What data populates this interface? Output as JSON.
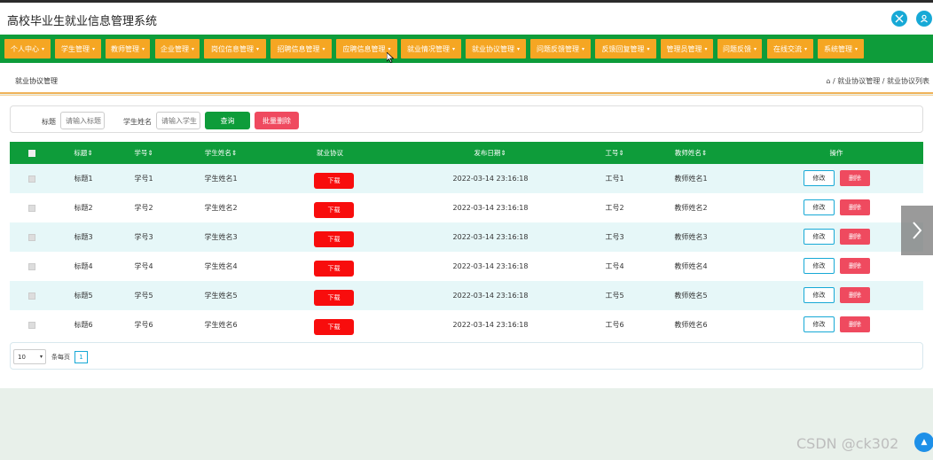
{
  "header": {
    "title": "高校毕业生就业信息管理系统",
    "fullscreen_icon": "fullscreen-icon",
    "user_icon": "user-icon"
  },
  "nav": [
    {
      "label": "个人中心"
    },
    {
      "label": "学生管理"
    },
    {
      "label": "教师管理"
    },
    {
      "label": "企业管理"
    },
    {
      "label": "岗位信息管理"
    },
    {
      "label": "招聘信息管理"
    },
    {
      "label": "应聘信息管理"
    },
    {
      "label": "就业情况管理"
    },
    {
      "label": "就业协议管理"
    },
    {
      "label": "问题反馈管理"
    },
    {
      "label": "反馈回复管理"
    },
    {
      "label": "管理员管理"
    },
    {
      "label": "问题反馈"
    },
    {
      "label": "在线交流"
    },
    {
      "label": "系统管理"
    }
  ],
  "breadcrumb": {
    "page_title": "就业协议管理",
    "home_icon": "home-icon",
    "trail": "/ 就业协议管理 / 就业协议列表"
  },
  "search": {
    "title_label": "标题",
    "title_placeholder": "请输入标题",
    "student_name_label": "学生姓名",
    "student_name_placeholder": "请输入学生",
    "query_label": "查询",
    "batch_delete_label": "批量删除"
  },
  "table": {
    "columns": [
      "标题",
      "学号",
      "学生姓名",
      "就业协议",
      "发布日期",
      "工号",
      "教师姓名",
      "操作"
    ],
    "download_label": "下载",
    "edit_label": "修改",
    "delete_label": "删除",
    "rows": [
      {
        "title": "标题1",
        "student_no": "学号1",
        "student_name": "学生姓名1",
        "date": "2022-03-14 23:16:18",
        "teacher_no": "工号1",
        "teacher_name": "教师姓名1"
      },
      {
        "title": "标题2",
        "student_no": "学号2",
        "student_name": "学生姓名2",
        "date": "2022-03-14 23:16:18",
        "teacher_no": "工号2",
        "teacher_name": "教师姓名2"
      },
      {
        "title": "标题3",
        "student_no": "学号3",
        "student_name": "学生姓名3",
        "date": "2022-03-14 23:16:18",
        "teacher_no": "工号3",
        "teacher_name": "教师姓名3"
      },
      {
        "title": "标题4",
        "student_no": "学号4",
        "student_name": "学生姓名4",
        "date": "2022-03-14 23:16:18",
        "teacher_no": "工号4",
        "teacher_name": "教师姓名4"
      },
      {
        "title": "标题5",
        "student_no": "学号5",
        "student_name": "学生姓名5",
        "date": "2022-03-14 23:16:18",
        "teacher_no": "工号5",
        "teacher_name": "教师姓名5"
      },
      {
        "title": "标题6",
        "student_no": "学号6",
        "student_name": "学生姓名6",
        "date": "2022-03-14 23:16:18",
        "teacher_no": "工号6",
        "teacher_name": "教师姓名6"
      }
    ]
  },
  "pagination": {
    "page_size": "10",
    "per_page_label": "条每页",
    "current_page": "1"
  },
  "watermark": "CSDN @ck302",
  "colors": {
    "primary_green": "#0e9c3a",
    "nav_orange": "#f5a623",
    "danger_red": "#ef4a5f",
    "download_red": "#f80d0d",
    "accent_blue": "#17a9d6",
    "row_stripe": "#e6f7f8"
  }
}
